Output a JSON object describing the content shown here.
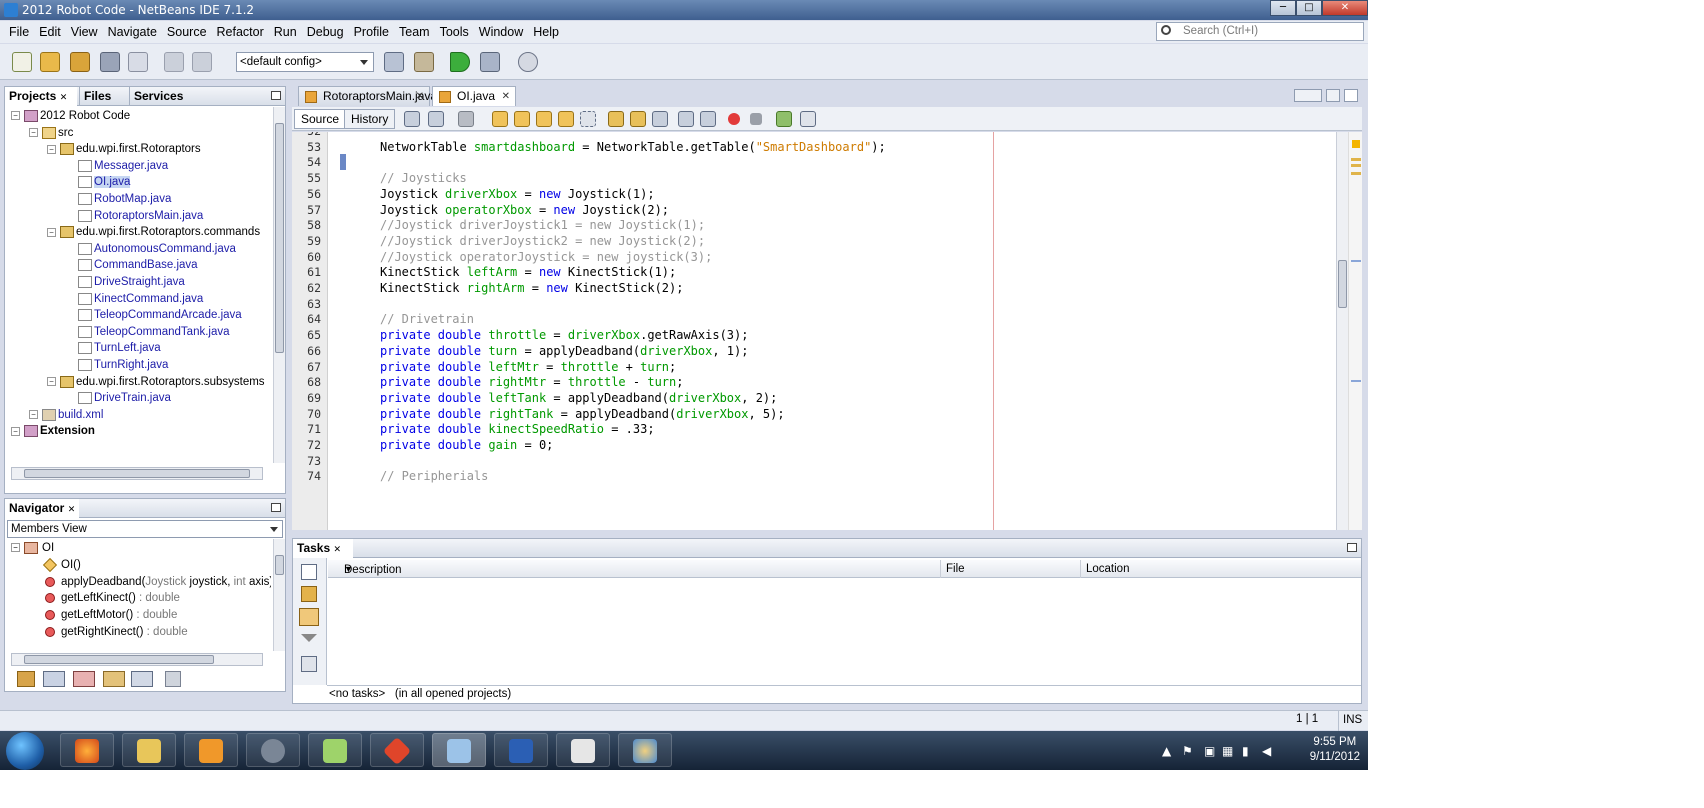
{
  "window": {
    "title": "2012 Robot Code - NetBeans IDE 7.1.2",
    "minimize": "─",
    "maximize": "□",
    "close": "✕"
  },
  "menu": [
    "File",
    "Edit",
    "View",
    "Navigate",
    "Source",
    "Refactor",
    "Run",
    "Debug",
    "Profile",
    "Team",
    "Tools",
    "Window",
    "Help"
  ],
  "search": {
    "placeholder": "Search (Ctrl+I)"
  },
  "toolbar": {
    "config": "<default config>"
  },
  "projects_panel": {
    "tabs": [
      "Projects",
      "Files",
      "Services"
    ],
    "tree": [
      {
        "label": "2012 Robot Code",
        "indent": 0,
        "icon": "project-icon"
      },
      {
        "label": "src",
        "indent": 1,
        "icon": "folder-icon"
      },
      {
        "label": "edu.wpi.first.Rotoraptors",
        "indent": 2,
        "icon": "package-icon"
      },
      {
        "label": "Messager.java",
        "indent": 3,
        "icon": "java-file-icon",
        "link": true
      },
      {
        "label": "OI.java",
        "indent": 3,
        "icon": "java-file-icon",
        "link": true,
        "selected": true
      },
      {
        "label": "RobotMap.java",
        "indent": 3,
        "icon": "java-file-icon",
        "link": true
      },
      {
        "label": "RotoraptorsMain.java",
        "indent": 3,
        "icon": "java-file-icon",
        "link": true
      },
      {
        "label": "edu.wpi.first.Rotoraptors.commands",
        "indent": 2,
        "icon": "package-icon"
      },
      {
        "label": "AutonomousCommand.java",
        "indent": 3,
        "icon": "java-file-icon",
        "link": true
      },
      {
        "label": "CommandBase.java",
        "indent": 3,
        "icon": "java-file-icon",
        "link": true
      },
      {
        "label": "DriveStraight.java",
        "indent": 3,
        "icon": "java-file-icon",
        "link": true
      },
      {
        "label": "KinectCommand.java",
        "indent": 3,
        "icon": "java-file-icon",
        "link": true
      },
      {
        "label": "TeleopCommandArcade.java",
        "indent": 3,
        "icon": "java-file-icon",
        "link": true
      },
      {
        "label": "TeleopCommandTank.java",
        "indent": 3,
        "icon": "java-file-icon",
        "link": true
      },
      {
        "label": "TurnLeft.java",
        "indent": 3,
        "icon": "java-file-icon",
        "link": true
      },
      {
        "label": "TurnRight.java",
        "indent": 3,
        "icon": "java-file-icon",
        "link": true
      },
      {
        "label": "edu.wpi.first.Rotoraptors.subsystems",
        "indent": 2,
        "icon": "package-icon"
      },
      {
        "label": "DriveTrain.java",
        "indent": 3,
        "icon": "java-file-icon",
        "link": true
      },
      {
        "label": "build.xml",
        "indent": 1,
        "icon": "xml-file-icon",
        "link": true
      },
      {
        "label": "Extension",
        "indent": 0,
        "icon": "project-icon",
        "bold": true
      }
    ]
  },
  "navigator": {
    "title": "Navigator",
    "view": "Members View",
    "root": "OI",
    "members": [
      {
        "name": "OI()",
        "type": ""
      },
      {
        "name": "applyDeadband(",
        "params_a": "Joystick",
        "params_b": " joystick, ",
        "params_c": "int",
        "params_d": " axis)",
        "type": ""
      },
      {
        "name": "getLeftKinect()",
        "type": " : double"
      },
      {
        "name": "getLeftMotor()",
        "type": " : double"
      },
      {
        "name": "getRightKinect()",
        "type": " : double"
      }
    ]
  },
  "editor": {
    "tabs": [
      {
        "label": "RotoraptorsMain.java",
        "active": false
      },
      {
        "label": "OI.java",
        "active": true
      }
    ],
    "source_btn": "Source",
    "history_btn": "History",
    "lines": [
      {
        "n": "52",
        "parts": []
      },
      {
        "n": "53",
        "parts": [
          [
            "",
            "NetworkTable "
          ],
          [
            "g",
            "smartdashboard"
          ],
          [
            "",
            " = NetworkTable.getTable("
          ],
          [
            "s",
            "\"SmartDashboard\""
          ],
          [
            "",
            ");"
          ]
        ]
      },
      {
        "n": "54",
        "parts": []
      },
      {
        "n": "55",
        "parts": [
          [
            "c",
            "// Joysticks"
          ]
        ]
      },
      {
        "n": "56",
        "parts": [
          [
            "",
            "Joystick "
          ],
          [
            "g",
            "driverXbox"
          ],
          [
            "",
            " = "
          ],
          [
            "k",
            "new"
          ],
          [
            "",
            " Joystick(1);"
          ]
        ]
      },
      {
        "n": "57",
        "parts": [
          [
            "",
            "Joystick "
          ],
          [
            "g",
            "operatorXbox"
          ],
          [
            "",
            " = "
          ],
          [
            "k",
            "new"
          ],
          [
            "",
            " Joystick(2);"
          ]
        ]
      },
      {
        "n": "58",
        "parts": [
          [
            "c",
            "//Joystick driverJoystick1 = new Joystick(1);"
          ]
        ]
      },
      {
        "n": "59",
        "parts": [
          [
            "c",
            "//Joystick driverJoystick2 = new Joystick(2);"
          ]
        ]
      },
      {
        "n": "60",
        "parts": [
          [
            "c",
            "//Joystick operatorJoystick = new joystick(3);"
          ]
        ]
      },
      {
        "n": "61",
        "parts": [
          [
            "",
            "KinectStick "
          ],
          [
            "g",
            "leftArm"
          ],
          [
            "",
            " = "
          ],
          [
            "k",
            "new"
          ],
          [
            "",
            " KinectStick(1);"
          ]
        ]
      },
      {
        "n": "62",
        "parts": [
          [
            "",
            "KinectStick "
          ],
          [
            "g",
            "rightArm"
          ],
          [
            "",
            " = "
          ],
          [
            "k",
            "new"
          ],
          [
            "",
            " KinectStick(2);"
          ]
        ]
      },
      {
        "n": "63",
        "parts": []
      },
      {
        "n": "64",
        "parts": [
          [
            "c",
            "// Drivetrain"
          ]
        ]
      },
      {
        "n": "65",
        "parts": [
          [
            "k",
            "private double "
          ],
          [
            "g",
            "throttle"
          ],
          [
            "",
            " = "
          ],
          [
            "g",
            "driverXbox"
          ],
          [
            "",
            ".getRawAxis(3);"
          ]
        ]
      },
      {
        "n": "66",
        "parts": [
          [
            "k",
            "private double "
          ],
          [
            "g",
            "turn"
          ],
          [
            "",
            " = applyDeadband("
          ],
          [
            "g",
            "driverXbox"
          ],
          [
            "",
            ", 1);"
          ]
        ]
      },
      {
        "n": "67",
        "parts": [
          [
            "k",
            "private double "
          ],
          [
            "g",
            "leftMtr"
          ],
          [
            "",
            " = "
          ],
          [
            "g",
            "throttle"
          ],
          [
            "",
            " + "
          ],
          [
            "g",
            "turn"
          ],
          [
            "",
            ";"
          ]
        ]
      },
      {
        "n": "68",
        "parts": [
          [
            "k",
            "private double "
          ],
          [
            "g",
            "rightMtr"
          ],
          [
            "",
            " = "
          ],
          [
            "g",
            "throttle"
          ],
          [
            "",
            " - "
          ],
          [
            "g",
            "turn"
          ],
          [
            "",
            ";"
          ]
        ]
      },
      {
        "n": "69",
        "parts": [
          [
            "k",
            "private double "
          ],
          [
            "g",
            "leftTank"
          ],
          [
            "",
            " = applyDeadband("
          ],
          [
            "g",
            "driverXbox"
          ],
          [
            "",
            ", 2);"
          ]
        ]
      },
      {
        "n": "70",
        "parts": [
          [
            "k",
            "private double "
          ],
          [
            "g",
            "rightTank"
          ],
          [
            "",
            " = applyDeadband("
          ],
          [
            "g",
            "driverXbox"
          ],
          [
            "",
            ", 5);"
          ]
        ]
      },
      {
        "n": "71",
        "parts": [
          [
            "k",
            "private double "
          ],
          [
            "g",
            "kinectSpeedRatio"
          ],
          [
            "",
            " = .33;"
          ]
        ]
      },
      {
        "n": "72",
        "parts": [
          [
            "k",
            "private double "
          ],
          [
            "g",
            "gain"
          ],
          [
            "",
            " = 0;"
          ]
        ]
      },
      {
        "n": "73",
        "parts": []
      },
      {
        "n": "74",
        "parts": [
          [
            "c",
            "// Peripherials"
          ]
        ]
      }
    ]
  },
  "tasks": {
    "title": "Tasks",
    "columns": [
      "Description",
      "File",
      "Location"
    ],
    "status_a": "<no tasks>",
    "status_b": "(in all opened projects)"
  },
  "status": {
    "position": "1 | 1",
    "mode": "INS"
  },
  "tray": {
    "time": "9:55 PM",
    "date": "9/11/2012"
  },
  "colors": {
    "keyword": "#0000e6",
    "field": "#009900",
    "comment": "#969696",
    "string": "#ce7b00"
  }
}
